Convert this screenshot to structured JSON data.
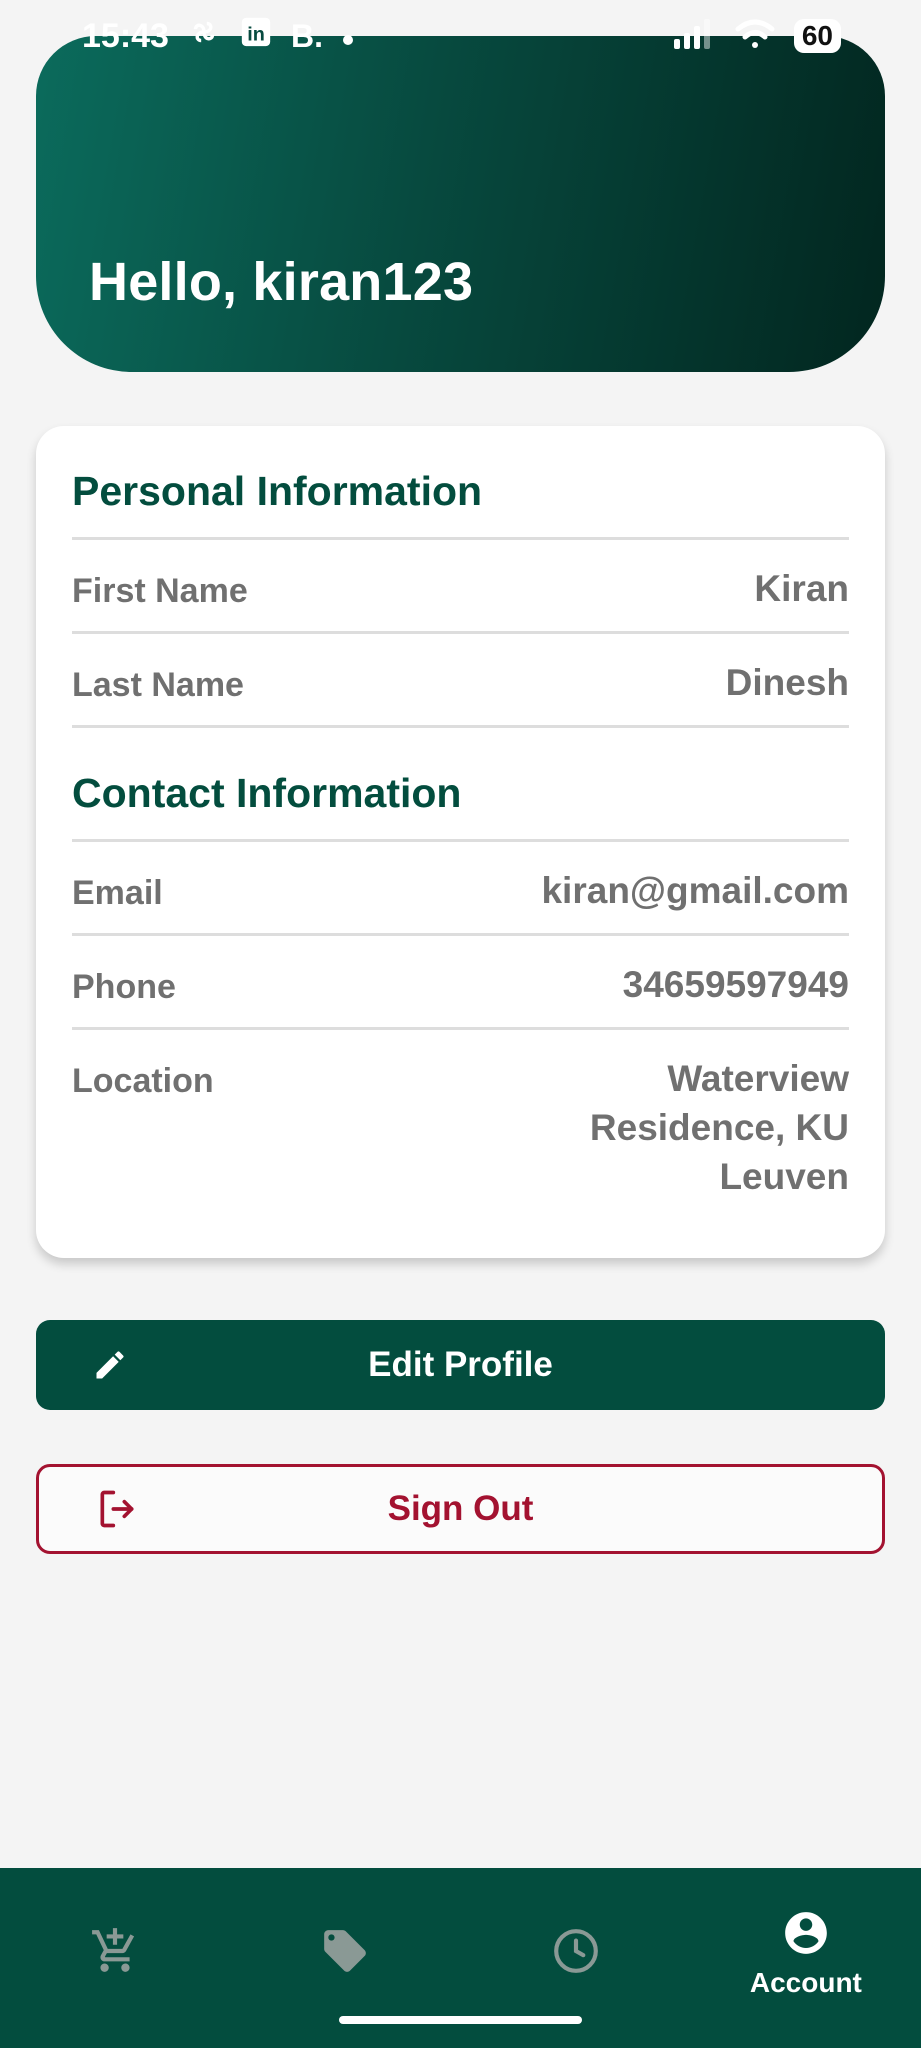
{
  "status_bar": {
    "time": "15:43",
    "icons": [
      "pinwheel-icon",
      "linkedin-icon",
      "b-app-icon",
      "dot-icon"
    ],
    "b_text": "B.",
    "linkedin_text": "in",
    "battery": "60"
  },
  "header": {
    "greeting": "Hello, kiran123"
  },
  "personal": {
    "title": "Personal Information",
    "rows": [
      {
        "label": "First Name",
        "value": "Kiran"
      },
      {
        "label": "Last Name",
        "value": "Dinesh"
      }
    ]
  },
  "contact": {
    "title": "Contact Information",
    "rows": [
      {
        "label": "Email",
        "value": "kiran@gmail.com"
      },
      {
        "label": "Phone",
        "value": "34659597949"
      },
      {
        "label": "Location",
        "value": "Waterview Residence, KU Leuven"
      }
    ]
  },
  "actions": {
    "edit_label": "Edit Profile",
    "edit_icon": "pencil-icon",
    "signout_label": "Sign Out",
    "signout_icon": "logout-icon"
  },
  "nav": {
    "items": [
      {
        "icon": "cart-add-icon",
        "label": ""
      },
      {
        "icon": "tag-icon",
        "label": ""
      },
      {
        "icon": "clock-icon",
        "label": ""
      },
      {
        "icon": "account-icon",
        "label": "Account"
      }
    ],
    "active_index": 3
  },
  "colors": {
    "brand": "#034d3e",
    "danger": "#a31230",
    "text_muted": "#707070",
    "background": "#f4f4f4"
  }
}
